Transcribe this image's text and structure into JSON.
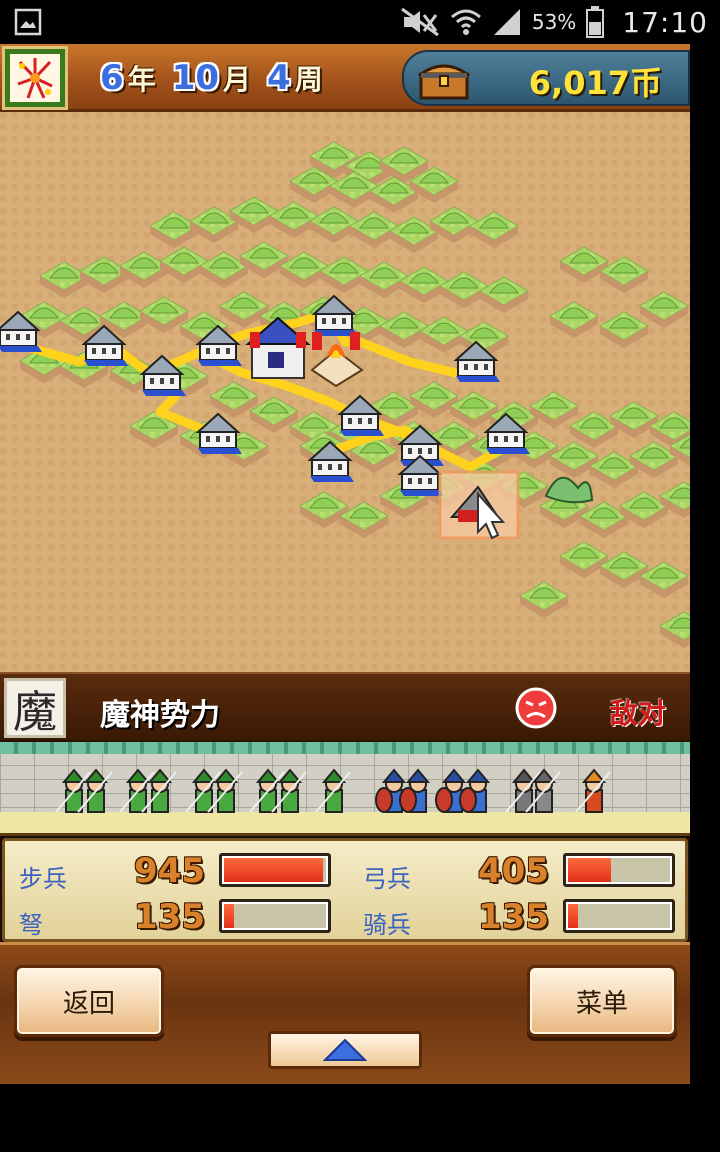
{
  "status_bar": {
    "battery_percent": "53%",
    "time": "17:10",
    "icons": [
      "gallery-icon",
      "mute-icon",
      "wifi-icon",
      "signal-icon",
      "battery-icon"
    ]
  },
  "header": {
    "logo_icon": "firework-logo-icon",
    "date": {
      "year": "6",
      "year_unit": "年",
      "month": "10",
      "month_unit": "月",
      "week": "4",
      "week_unit": "周"
    },
    "treasury_icon": "treasure-chest-icon",
    "money": "6,017币"
  },
  "faction": {
    "emblem": "魔",
    "name": "魔神势力",
    "relation_icon": "angry-face-icon",
    "relation": "敌对"
  },
  "stats": [
    {
      "label": "步兵",
      "value": "945",
      "fill": 0.97
    },
    {
      "label": "弓兵",
      "value": "405",
      "fill": 0.42
    },
    {
      "label": "弩",
      "value": "135",
      "fill": 0.1
    },
    {
      "label": "骑兵",
      "value": "135",
      "fill": 0.1
    }
  ],
  "buttons": {
    "back": "返回",
    "menu": "菜单",
    "expand_icon": "triangle-up-icon"
  },
  "colors": {
    "money": "#ffe23a",
    "hostile": "#d51818",
    "stat_label": "#3b63c0",
    "bar_fill": "#e0301a"
  }
}
